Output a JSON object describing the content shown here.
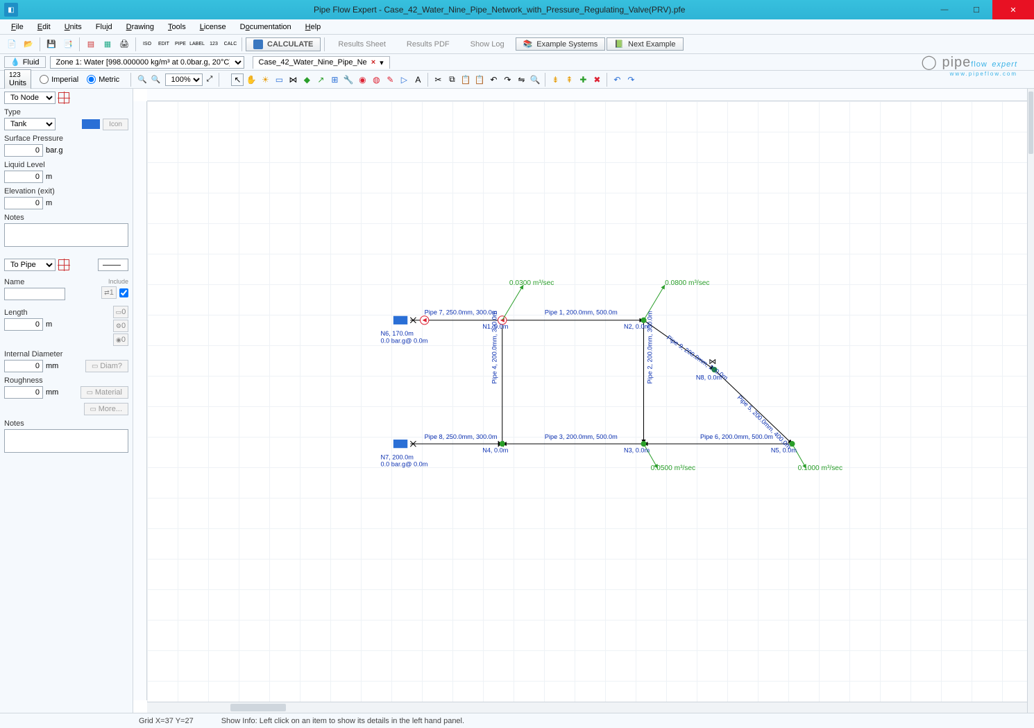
{
  "window": {
    "title": "Pipe Flow Expert - Case_42_Water_Nine_Pipe_Network_with_Pressure_Regulating_Valve(PRV).pfe"
  },
  "menu": [
    "File",
    "Edit",
    "Units",
    "Fluid",
    "Drawing",
    "Tools",
    "License",
    "Documentation",
    "Help"
  ],
  "buttons": {
    "calculate": "CALCULATE",
    "results_sheet": "Results Sheet",
    "results_pdf": "Results PDF",
    "show_log": "Show Log",
    "example_systems": "Example Systems",
    "next_example": "Next Example"
  },
  "zonebar": {
    "fluid": "Fluid",
    "zone": "Zone 1: Water [998.000000 kg/m³ at 0.0bar.g, 20°C]",
    "tab": "Case_42_Water_Nine_Pipe_Ne"
  },
  "unitsbar": {
    "units": "Units",
    "imperial": "Imperial",
    "metric": "Metric",
    "zoom": "100%"
  },
  "sidebar": {
    "to_node": "To Node",
    "type_label": "Type",
    "type_value": "Tank",
    "icon_label": "Icon",
    "surface_pressure_label": "Surface Pressure",
    "surface_pressure_value": "0",
    "surface_pressure_unit": "bar.g",
    "liquid_level_label": "Liquid Level",
    "liquid_level_value": "0",
    "liquid_level_unit": "m",
    "elevation_label": "Elevation (exit)",
    "elevation_value": "0",
    "elevation_unit": "m",
    "notes_label": "Notes",
    "to_pipe": "To Pipe",
    "name_label": "Name",
    "include_label": "Include",
    "length_label": "Length",
    "length_value": "0",
    "length_unit": "m",
    "internal_diameter_label": "Internal Diameter",
    "internal_diameter_value": "0",
    "internal_diameter_unit": "mm",
    "diam_btn": "Diam?",
    "roughness_label": "Roughness",
    "roughness_value": "0",
    "roughness_unit": "mm",
    "material_btn": "Material",
    "more_btn": "More...",
    "mini_count1": "1",
    "mini_count2": "0",
    "mini_count3": "0",
    "mini_count4": "0"
  },
  "diagram": {
    "pipes": {
      "p1": "Pipe 1, 200.0mm, 500.0m",
      "p2": "Pipe 2, 200.0mm, 300.0m",
      "p3": "Pipe 3, 200.0mm, 500.0m",
      "p4": "Pipe 4, 200.0mm, 300.0m",
      "p5": "Pipe 5, 200.0mm, 400.0m",
      "p6": "Pipe 6, 200.0mm, 500.0m",
      "p7": "Pipe 7, 250.0mm, 300.0m",
      "p8": "Pipe 8, 250.0mm, 300.0m",
      "p9": "Pipe 9, 200.0mm, 200.0m"
    },
    "nodes": {
      "n1": "N1, 0.0m",
      "n2": "N2, 0.0m",
      "n3": "N3, 0.0m",
      "n4": "N4, 0.0m",
      "n5": "N5, 0.0m",
      "n8": "N8, 0.0m"
    },
    "tanks": {
      "n6a": "N6, 170.0m",
      "n6b": "0.0 bar.g@ 0.0m",
      "n7a": "N7, 200.0m",
      "n7b": "0.0 bar.g@ 0.0m"
    },
    "flows": {
      "f1": "0.0300 m³/sec",
      "f2": "0.0800 m³/sec",
      "f3": "0.0500 m³/sec",
      "f4": "0.1000 m³/sec"
    }
  },
  "status": {
    "grid": "Grid  X=37  Y=27",
    "info": "Show Info: Left click on an item to show its details in the left hand panel."
  }
}
